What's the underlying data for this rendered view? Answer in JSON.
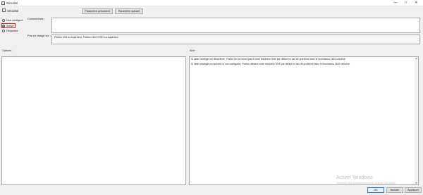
{
  "window": {
    "title": "Sécurisé",
    "minimize_glyph": "—",
    "maximize_glyph": "□",
    "close_glyph": "✕"
  },
  "header": {
    "title": "Sécurisé",
    "prev_setting": "Paramètre précédent",
    "next_setting": "Paramètre suivant"
  },
  "state": {
    "options": [
      {
        "label": "Non configuré",
        "selected": false
      },
      {
        "label": "Activé",
        "selected": true
      },
      {
        "label": "Désactivé",
        "selected": false
      }
    ]
  },
  "labels": {
    "comment": "Commentaire :",
    "supported_on": "Pris en charge sur :",
    "options": "Options :",
    "help": "Aide :"
  },
  "supported_on_value": "Firefox 124 ou supérieur, Firefox 115.9 ESR ou supérieur",
  "help_text": [
    "Si cette stratégie est désactivée, Firefox ne se rendra pas à votre résolveur DNS par défaut en cas de problème avec le fournisseur DNS sécurisé.",
    "Si cette stratégie est activée ou non configurée, Firefox utilisera votre résolveur DNS par défaut en cas de problème avec le fournisseur DNS sécurisé."
  ],
  "watermark": {
    "title": "Activer Windows",
    "subtitle": "Accédez aux paramètres pour activer Windows."
  },
  "footer": {
    "ok": "OK",
    "cancel": "Annuler",
    "apply": "Appliquer"
  }
}
